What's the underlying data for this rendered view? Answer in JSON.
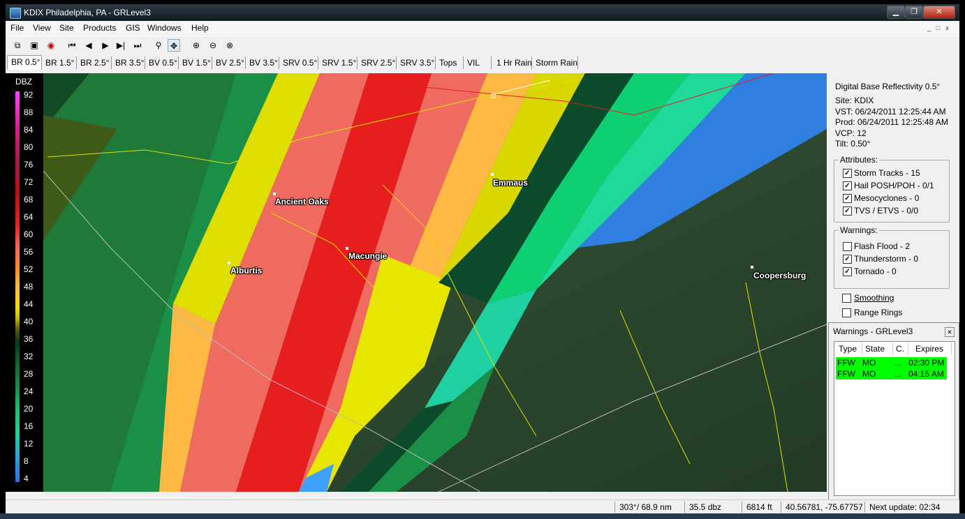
{
  "window": {
    "title": "KDIX Philadelphia, PA - GRLevel3"
  },
  "menu": [
    "File",
    "View",
    "Site",
    "Products",
    "GIS",
    "Windows",
    "Help"
  ],
  "toolbar_icons": [
    "copy-icon",
    "paste-icon",
    "record-icon",
    "first-frame-icon",
    "prev-frame-icon",
    "play-icon",
    "next-frame-icon",
    "last-frame-icon",
    "zoom-icon",
    "pan-icon",
    "zoom-in-icon",
    "zoom-out-icon",
    "zoom-reset-icon"
  ],
  "tabs": [
    "BR 0.5°",
    "BR 1.5°",
    "BR 2.5°",
    "BR 3.5°",
    "BV 0.5°",
    "BV 1.5°",
    "BV 2.5°",
    "BV 3.5°",
    "SRV 0.5°",
    "SRV 1.5°",
    "SRV 2.5°",
    "SRV 3.5°",
    "Tops",
    "VIL",
    "1 Hr Rain",
    "Storm Rain"
  ],
  "legend": {
    "unit": "DBZ",
    "ticks": [
      "92",
      "88",
      "84",
      "80",
      "76",
      "72",
      "68",
      "64",
      "60",
      "56",
      "52",
      "48",
      "44",
      "40",
      "36",
      "32",
      "28",
      "24",
      "20",
      "16",
      "12",
      "8",
      "4"
    ]
  },
  "cities": [
    "Ancient Oaks",
    "Emmaus",
    "Alburtis",
    "Macungie",
    "Coopersburg"
  ],
  "info": {
    "product": "Digital Base Reflectivity 0.5°",
    "site": "Site:  KDIX",
    "vst": "VST:  06/24/2011  12:25:44 AM",
    "prod": "Prod: 06/24/2011  12:25:48 AM",
    "vcp": "VCP:  12",
    "tilt": "Tilt:   0.50°"
  },
  "attributes": {
    "label": "Attributes:",
    "items": [
      {
        "label": "Storm Tracks - 15",
        "checked": true
      },
      {
        "label": "Hail POSH/POH - 0/1",
        "checked": true
      },
      {
        "label": "Mesocyclones - 0",
        "checked": true
      },
      {
        "label": "TVS / ETVS - 0/0",
        "checked": true
      }
    ]
  },
  "warnings_group": {
    "label": "Warnings:",
    "items": [
      {
        "label": "Flash Flood - 2",
        "checked": false
      },
      {
        "label": "Thunderstorm - 0",
        "checked": true
      },
      {
        "label": "Tornado - 0",
        "checked": true
      }
    ]
  },
  "options": [
    {
      "label": "Smoothing",
      "checked": false
    },
    {
      "label": "Range Rings",
      "checked": false
    }
  ],
  "warnings_window": {
    "title": "Warnings - GRLevel3",
    "columns": [
      "Type",
      "State",
      "C.",
      "Expires"
    ],
    "rows": [
      {
        "type": "FFW",
        "state": "MO",
        "c": "...",
        "expires": "02:30 PM"
      },
      {
        "type": "FFW",
        "state": "MO",
        "c": "...",
        "expires": "04:15 AM"
      }
    ]
  },
  "status": {
    "bearing": "303°/ 68.9 nm",
    "dbz": "35.5 dbz",
    "height": "6814 ft",
    "coords": "40.56781, -75.67757",
    "next": "Next update: 02:34"
  }
}
